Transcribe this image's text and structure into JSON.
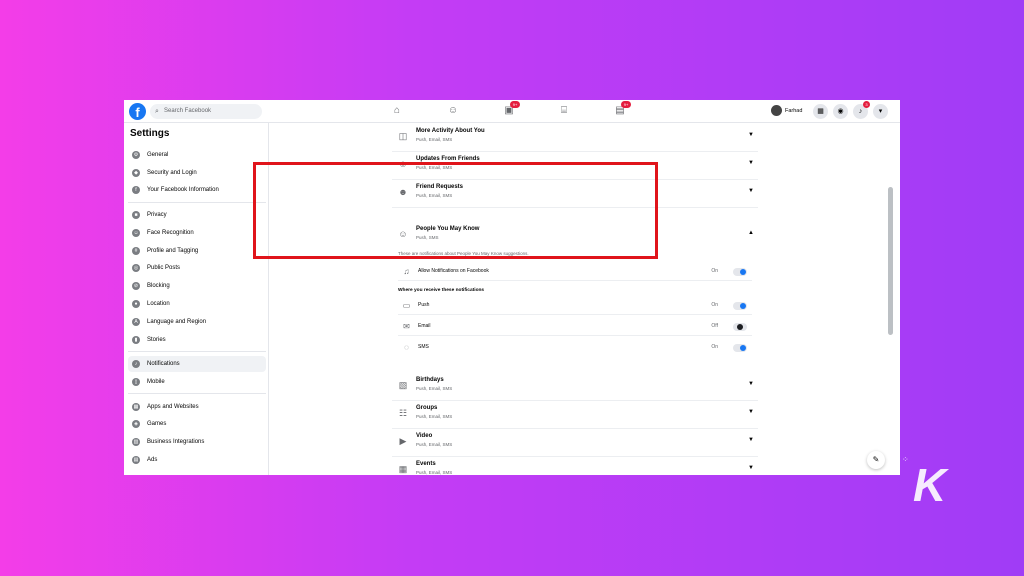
{
  "topbar": {
    "search_placeholder": "Search Facebook",
    "logo_letter": "f",
    "profile_name": "Farhad",
    "friends_badge": "9+",
    "watch_badge": "9+",
    "notif_badge": "3"
  },
  "sidebar": {
    "title": "Settings",
    "items": [
      {
        "label": "General",
        "icon": "gear-icon"
      },
      {
        "label": "Security and Login",
        "icon": "shield-icon"
      },
      {
        "label": "Your Facebook Information",
        "icon": "facebook-icon"
      },
      {
        "label": "Privacy",
        "icon": "lock-icon"
      },
      {
        "label": "Face Recognition",
        "icon": "face-icon"
      },
      {
        "label": "Profile and Tagging",
        "icon": "tag-icon"
      },
      {
        "label": "Public Posts",
        "icon": "globe-icon"
      },
      {
        "label": "Blocking",
        "icon": "block-icon"
      },
      {
        "label": "Location",
        "icon": "location-icon"
      },
      {
        "label": "Language and Region",
        "icon": "language-icon"
      },
      {
        "label": "Stories",
        "icon": "stories-icon"
      },
      {
        "label": "Notifications",
        "icon": "bell-icon"
      },
      {
        "label": "Mobile",
        "icon": "mobile-icon"
      },
      {
        "label": "Apps and Websites",
        "icon": "apps-icon"
      },
      {
        "label": "Games",
        "icon": "games-icon"
      },
      {
        "label": "Business Integrations",
        "icon": "business-icon"
      },
      {
        "label": "Ads",
        "icon": "ads-icon"
      }
    ]
  },
  "main": {
    "rows_top": [
      {
        "title": "More Activity About You",
        "sub": "Push, Email, SMS"
      },
      {
        "title": "Updates From Friends",
        "sub": "Push, Email, SMS"
      },
      {
        "title": "Friend Requests",
        "sub": "Push, Email, SMS"
      },
      {
        "title": "People You May Know",
        "sub": "Push, SMS"
      }
    ],
    "description": "These are notifications about People You May Know suggestions.",
    "allow_label": "Allow Notifications on Facebook",
    "allow_state": "On",
    "where_label": "Where you receive these notifications",
    "channels": [
      {
        "label": "Push",
        "state": "On",
        "on": true
      },
      {
        "label": "Email",
        "state": "Off",
        "on": false
      },
      {
        "label": "SMS",
        "state": "On",
        "on": true
      }
    ],
    "rows_bottom": [
      {
        "title": "Birthdays",
        "sub": "Push, Email, SMS"
      },
      {
        "title": "Groups",
        "sub": "Push, Email, SMS"
      },
      {
        "title": "Video",
        "sub": "Push, Email, SMS"
      },
      {
        "title": "Events",
        "sub": "Push, Email, SMS"
      }
    ]
  },
  "watermark": {
    "letter": "K"
  },
  "colors": {
    "accent": "#1877f2",
    "highlight": "#e0141b"
  }
}
